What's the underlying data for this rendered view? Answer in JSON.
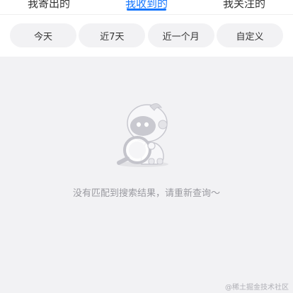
{
  "tabs": [
    {
      "label": "我寄出的",
      "active": false
    },
    {
      "label": "我收到的",
      "active": true
    },
    {
      "label": "我关注的",
      "active": false
    }
  ],
  "filters": [
    "今天",
    "近7天",
    "近一个月",
    "自定义"
  ],
  "empty_state": {
    "illustration_icon": "robot-magnifier-icon",
    "message": "没有匹配到搜索结果，请重新查询～"
  },
  "watermark": "@稀土掘金技术社区",
  "colors": {
    "accent": "#1677ff",
    "background": "#f2f2f4",
    "chip_bg": "#f2f2f4",
    "muted_text": "#9a9aa0"
  }
}
